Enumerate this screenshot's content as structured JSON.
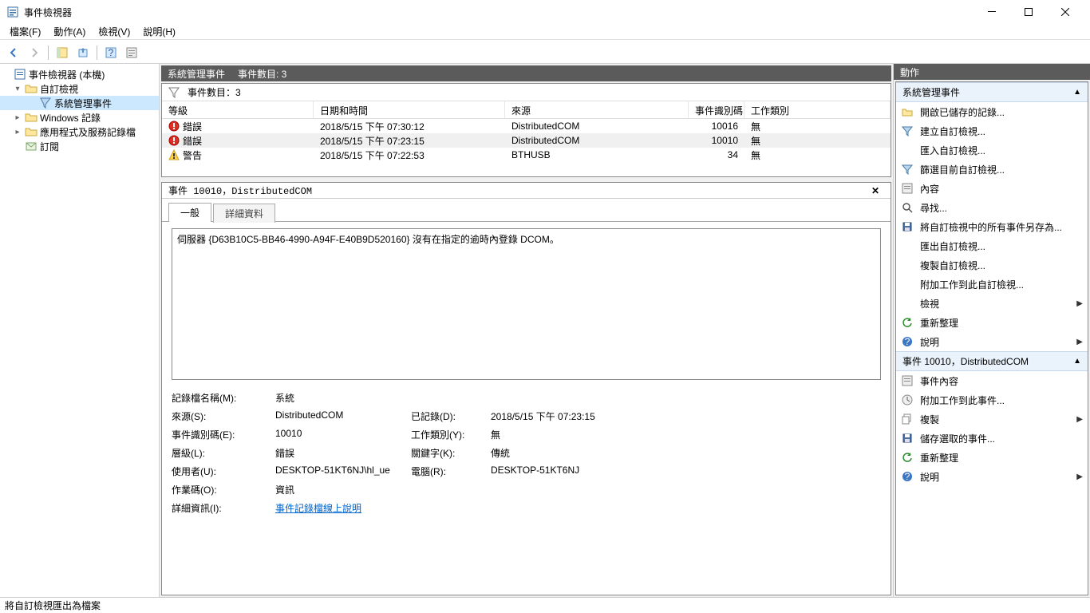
{
  "window": {
    "title": "事件檢視器"
  },
  "menu": {
    "file": "檔案(F)",
    "action": "動作(A)",
    "view": "檢視(V)",
    "help": "說明(H)"
  },
  "tree": {
    "root": "事件檢視器 (本機)",
    "custom": "自訂檢視",
    "adminEvents": "系統管理事件",
    "winLogs": "Windows 記錄",
    "appSvc": "應用程式及服務記錄檔",
    "subs": "訂閱"
  },
  "centerHeader": {
    "title": "系統管理事件",
    "count": "事件數目: 3"
  },
  "filter": {
    "countLabel": "事件數目：3"
  },
  "columns": {
    "level": "等級",
    "date": "日期和時間",
    "source": "來源",
    "id": "事件識別碼",
    "cat": "工作類別"
  },
  "rows": [
    {
      "level": "錯誤",
      "date": "2018/5/15 下午 07:30:12",
      "source": "DistributedCOM",
      "id": "10016",
      "cat": "無",
      "icon": "error"
    },
    {
      "level": "錯誤",
      "date": "2018/5/15 下午 07:23:15",
      "source": "DistributedCOM",
      "id": "10010",
      "cat": "無",
      "icon": "error"
    },
    {
      "level": "警告",
      "date": "2018/5/15 下午 07:22:53",
      "source": "BTHUSB",
      "id": "34",
      "cat": "無",
      "icon": "warn"
    }
  ],
  "detail": {
    "header": "事件 10010，DistributedCOM",
    "tab_general": "一般",
    "tab_details": "詳細資料",
    "message": "伺服器 {D63B10C5-BB46-4990-A94F-E40B9D520160} 沒有在指定的逾時內登錄 DCOM。",
    "props": {
      "logNameL": "記錄檔名稱(M):",
      "logNameV": "系統",
      "sourceL": "來源(S):",
      "sourceV": "DistributedCOM",
      "loggedL": "已記錄(D):",
      "loggedV": "2018/5/15 下午 07:23:15",
      "eventIdL": "事件識別碼(E):",
      "eventIdV": "10010",
      "taskCatL": "工作類別(Y):",
      "taskCatV": "無",
      "levelL": "層級(L):",
      "levelV": "錯誤",
      "keywordsL": "關鍵字(K):",
      "keywordsV": "傳統",
      "userL": "使用者(U):",
      "userV": "DESKTOP-51KT6NJ\\hl_ue",
      "computerL": "電腦(R):",
      "computerV": "DESKTOP-51KT6NJ",
      "opcodeL": "作業碼(O):",
      "opcodeV": "資訊",
      "moreInfoL": "詳細資訊(I):",
      "moreInfoV": "事件記錄檔線上說明"
    }
  },
  "actions": {
    "title": "動作",
    "section1": "系統管理事件",
    "items1": [
      {
        "t": "開啟已儲存的記錄...",
        "i": "folder"
      },
      {
        "t": "建立自訂檢視...",
        "i": "filter"
      },
      {
        "t": "匯入自訂檢視...",
        "i": "blank"
      },
      {
        "t": "篩選目前自訂檢視...",
        "i": "filter"
      },
      {
        "t": "內容",
        "i": "props"
      },
      {
        "t": "尋找...",
        "i": "find"
      },
      {
        "t": "將自訂檢視中的所有事件另存為...",
        "i": "save"
      },
      {
        "t": "匯出自訂檢視...",
        "i": "blank"
      },
      {
        "t": "複製自訂檢視...",
        "i": "blank"
      },
      {
        "t": "附加工作到此自訂檢視...",
        "i": "blank"
      },
      {
        "t": "檢視",
        "i": "blank",
        "sub": true
      },
      {
        "t": "重新整理",
        "i": "refresh"
      },
      {
        "t": "說明",
        "i": "help",
        "sub": true
      }
    ],
    "section2": "事件 10010，DistributedCOM",
    "items2": [
      {
        "t": "事件內容",
        "i": "props"
      },
      {
        "t": "附加工作到此事件...",
        "i": "task"
      },
      {
        "t": "複製",
        "i": "copy",
        "sub": true
      },
      {
        "t": "儲存選取的事件...",
        "i": "save"
      },
      {
        "t": "重新整理",
        "i": "refresh"
      },
      {
        "t": "說明",
        "i": "help",
        "sub": true
      }
    ]
  },
  "status": "將自訂檢視匯出為檔案"
}
